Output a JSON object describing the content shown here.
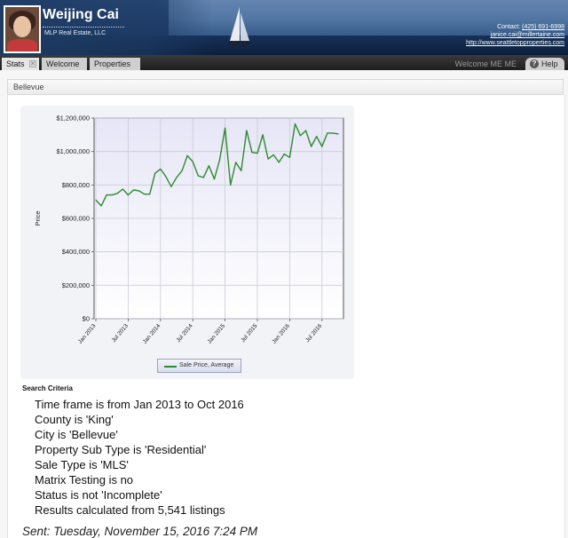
{
  "header": {
    "agent_name": "Weijing Cai",
    "company": "MLP Real Estate, LLC",
    "contact_label": "Contact:",
    "phone": "(425) 691-6998",
    "email": "janice.cai@millertaine.com",
    "website": "http://www.seattletopproperties.com"
  },
  "tabs": [
    {
      "label": "Stats"
    },
    {
      "label": "Welcome"
    },
    {
      "label": "Properties"
    }
  ],
  "welcome_user": "Welcome ME ME",
  "help_label": "Help",
  "section_title": "Bellevue",
  "chart_data": {
    "type": "line",
    "ylabel": "Price",
    "ylim": [
      0,
      1200000
    ],
    "y_ticks": [
      "$0",
      "$200,000",
      "$400,000",
      "$600,000",
      "$800,000",
      "$1,000,000",
      "$1,200,000"
    ],
    "x_tick_labels": [
      "Jan 2013",
      "Jul 2013",
      "Jan 2014",
      "Jul 2014",
      "Jan 2015",
      "Jul 2015",
      "Jan 2016",
      "Jul 2016"
    ],
    "x": [
      "Jan 2013",
      "Feb 2013",
      "Mar 2013",
      "Apr 2013",
      "May 2013",
      "Jun 2013",
      "Jul 2013",
      "Aug 2013",
      "Sep 2013",
      "Oct 2013",
      "Nov 2013",
      "Dec 2013",
      "Jan 2014",
      "Feb 2014",
      "Mar 2014",
      "Apr 2014",
      "May 2014",
      "Jun 2014",
      "Jul 2014",
      "Aug 2014",
      "Sep 2014",
      "Oct 2014",
      "Nov 2014",
      "Dec 2014",
      "Jan 2015",
      "Feb 2015",
      "Mar 2015",
      "Apr 2015",
      "May 2015",
      "Jun 2015",
      "Jul 2015",
      "Aug 2015",
      "Sep 2015",
      "Oct 2015",
      "Nov 2015",
      "Dec 2015",
      "Jan 2016",
      "Feb 2016",
      "Mar 2016",
      "Apr 2016",
      "May 2016",
      "Jun 2016",
      "Jul 2016",
      "Aug 2016",
      "Sep 2016",
      "Oct 2016"
    ],
    "series": [
      {
        "name": "Sale Price, Average",
        "color": "#2e8b2e",
        "values": [
          710000,
          675000,
          740000,
          740000,
          750000,
          775000,
          740000,
          770000,
          765000,
          745000,
          745000,
          870000,
          895000,
          850000,
          790000,
          845000,
          885000,
          975000,
          940000,
          855000,
          845000,
          915000,
          835000,
          950000,
          1140000,
          800000,
          935000,
          885000,
          1125000,
          995000,
          990000,
          1100000,
          955000,
          980000,
          935000,
          985000,
          965000,
          1165000,
          1095000,
          1125000,
          1030000,
          1090000,
          1030000,
          1110000,
          1110000,
          1105000
        ]
      }
    ],
    "grid": true,
    "legend": "bottom"
  },
  "criteria": {
    "title": "Search Criteria",
    "lines": [
      "Time frame is from Jan 2013 to Oct 2016",
      "County is 'King'",
      "City is 'Bellevue'",
      "Property Sub Type is 'Residential'",
      "Sale Type is 'MLS'",
      "Matrix Testing is no",
      "Status is not 'Incomplete'",
      "Results calculated from 5,541 listings"
    ]
  },
  "sent": "Sent: Tuesday, November 15, 2016 7:24 PM"
}
